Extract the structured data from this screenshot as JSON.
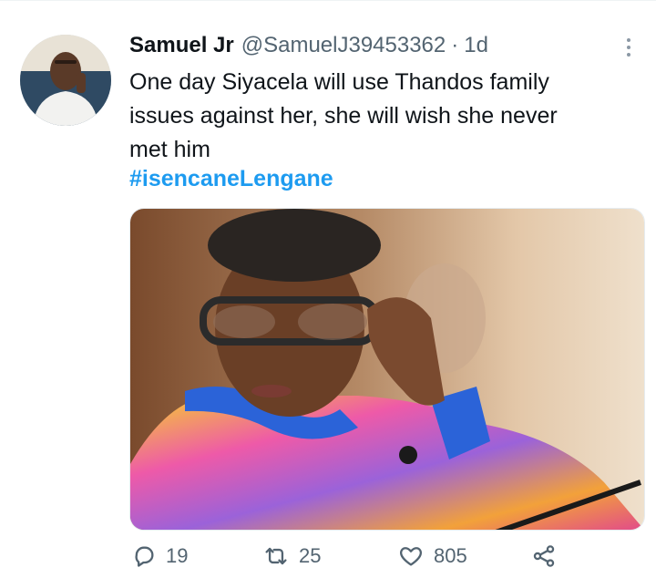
{
  "tweet": {
    "author_name": "Samuel Jr",
    "author_handle": "@SamuelJ39453362",
    "separator": "·",
    "timestamp": "1d",
    "text_lines": [
      "One day Siyacela will use Thandos family",
      "issues against her, she will wish she never",
      "met him"
    ],
    "hashtag": "#isencaneLengane"
  },
  "actions": {
    "replies": "19",
    "retweets": "25",
    "likes": "805"
  },
  "icons": {
    "reply": "reply-icon",
    "retweet": "retweet-icon",
    "like": "heart-icon",
    "share": "share-icon",
    "more": "more-icon"
  },
  "colors": {
    "hashtag": "#1d9bf0",
    "muted": "#536471",
    "text": "#0f1419"
  }
}
